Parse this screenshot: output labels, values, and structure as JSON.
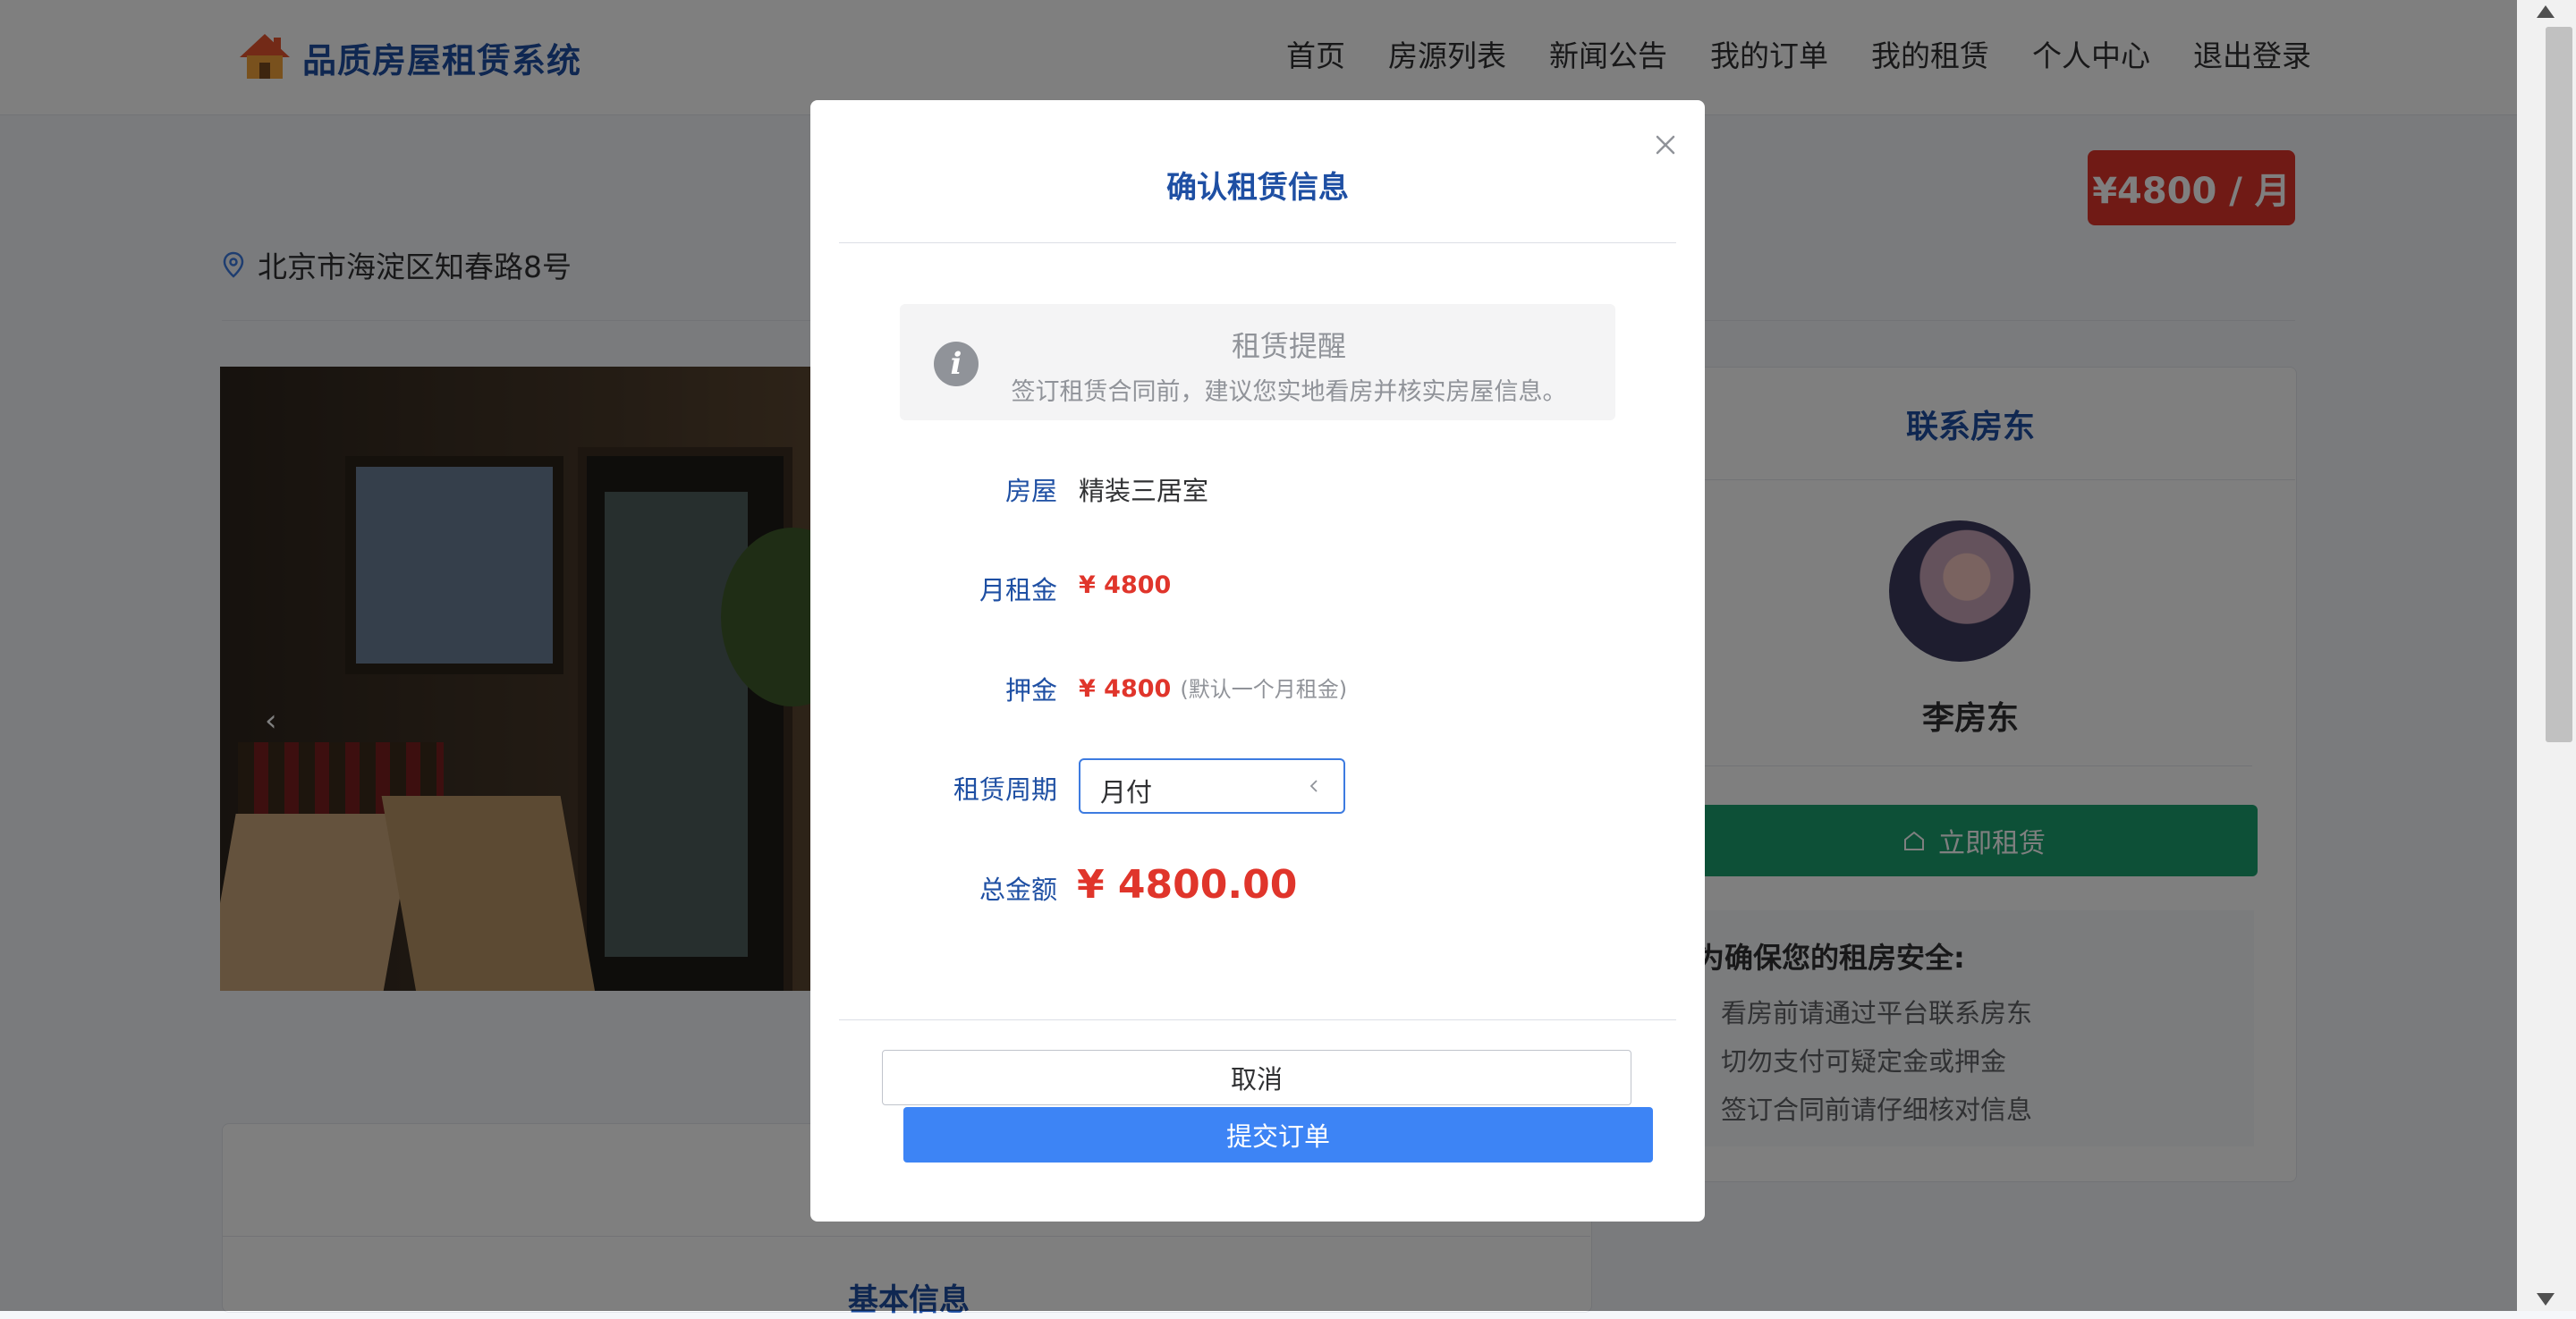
{
  "header": {
    "logo_text": "品质房屋租赁系统",
    "nav": [
      "首页",
      "房源列表",
      "新闻公告",
      "我的订单",
      "我的租赁",
      "个人中心",
      "退出登录"
    ]
  },
  "property": {
    "price_tag": "¥4800 / 月",
    "address": "北京市海淀区知春路8号"
  },
  "landlord_card": {
    "title": "联系房东",
    "name": "李房东",
    "rent_button": "立即租赁",
    "safety_title": "为确保您的租房安全:",
    "safety_items": [
      "看房前请通过平台联系房东",
      "切勿支付可疑定金或押金",
      "签订合同前请仔细核对信息"
    ]
  },
  "bottom": {
    "basic_info": "基本信息"
  },
  "dialog": {
    "title": "确认租赁信息",
    "alert": {
      "title": "租赁提醒",
      "description": "签订租赁合同前，建议您实地看房并核实房屋信息。"
    },
    "fields": {
      "house_label": "房屋",
      "house_value": "精装三居室",
      "rent_label": "月租金",
      "rent_value": "¥ 4800",
      "deposit_label": "押金",
      "deposit_value": "¥ 4800",
      "deposit_note": "(默认一个月租金)",
      "period_label": "租赁周期",
      "period_value": "月付",
      "total_label": "总金额",
      "total_value": "¥ 4800.00"
    },
    "cancel_button": "取消",
    "submit_button": "提交订单"
  },
  "colors": {
    "brand_blue": "#1e4fa3",
    "price_red": "#e0352b",
    "primary_button": "#3d84f5",
    "rent_green": "#1aa06e"
  }
}
